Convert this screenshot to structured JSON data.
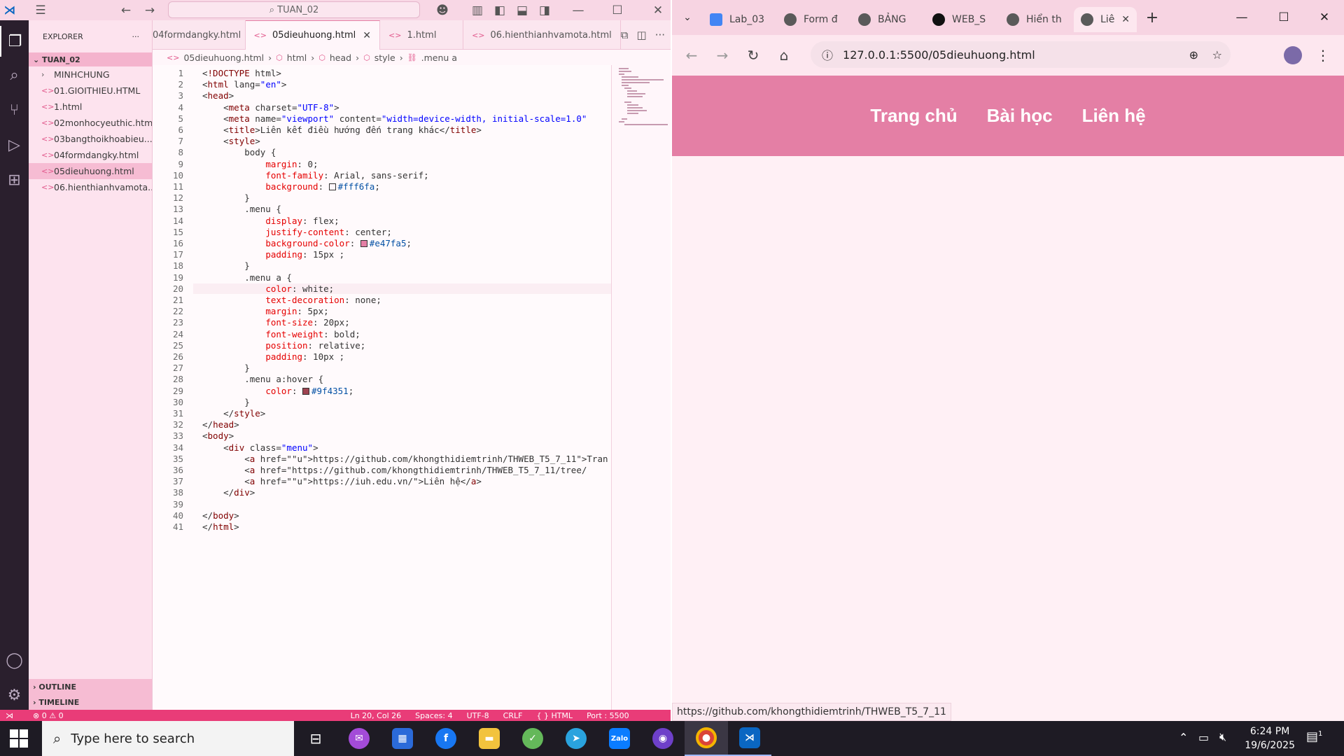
{
  "vscode": {
    "search": "TUAN_02",
    "explorer_label": "EXPLORER",
    "folder": "TUAN_02",
    "files": [
      "MINHCHUNG",
      "01.GIOITHIEU.HTML",
      "1.html",
      "02monhocyeuthic.html",
      "03bangthoikhoabieu....",
      "04formdangky.html",
      "05dieuhuong.html",
      "06.hienthianhvamota...."
    ],
    "outline": "OUTLINE",
    "timeline": "TIMELINE",
    "tabs": [
      "04formdangky.html",
      "05dieuhuong.html",
      "1.html",
      "06.hienthianhvamota.html"
    ],
    "breadcrumb": [
      "05dieuhuong.html",
      "html",
      "head",
      "style",
      ".menu a"
    ],
    "status": {
      "errors": "⊗ 0 ⚠ 0",
      "pos": "Ln 20, Col 26",
      "spaces": "Spaces: 4",
      "enc": "UTF-8",
      "eol": "CRLF",
      "lang": "{ } HTML",
      "port": "Port : 5500"
    },
    "code_lines": [
      "<!DOCTYPE html>",
      "<html lang=\"en\">",
      "<head>",
      "    <meta charset=\"UTF-8\">",
      "    <meta name=\"viewport\" content=\"width=device-width, initial-scale=1.0\"",
      "    <title>Liên kết điều hướng đến trang khác</title>",
      "    <style>",
      "        body {",
      "            margin: 0;",
      "            font-family: Arial, sans-serif;",
      "            background: #fff6fa;",
      "        }",
      "        .menu {",
      "            display: flex;",
      "            justify-content: center;",
      "            background-color: #e47fa5;",
      "            padding: 15px ;",
      "        }",
      "        .menu a {",
      "            color: white;",
      "            text-decoration: none;",
      "            margin: 5px;",
      "            font-size: 20px;",
      "            font-weight: bold;",
      "            position: relative;",
      "            padding: 10px ;",
      "        }",
      "        .menu a:hover {",
      "            color: #9f4351;",
      "        }",
      "    </style>",
      "</head>",
      "<body>",
      "    <div class=\"menu\">",
      "        <a href=\"https://github.com/khongthidiemtrinh/THWEB_T5_7_11\">Tran",
      "        <a href=\"https://github.com/khongthidiemtrinh/THWEB_T5_7_11/tree/",
      "        <a href=\"https://iuh.edu.vn/\">Liên hệ</a>",
      "    </div>",
      "",
      "</body>",
      "</html>"
    ]
  },
  "chrome": {
    "tabs": [
      "Lab_03",
      "Form đ",
      "BẢNG",
      "WEB_S",
      "Hiển th",
      "Liê"
    ],
    "url": "127.0.0.1:5500/05dieuhuong.html",
    "menu": [
      "Trang chủ",
      "Bài học",
      "Liên hệ"
    ],
    "hover_url": "https://github.com/khongthidiemtrinh/THWEB_T5_7_11"
  },
  "taskbar": {
    "search_placeholder": "Type here to search",
    "time": "6:24 PM",
    "date": "19/6/2025",
    "notif": "1"
  },
  "colors": {
    "menu_bg": "#e47fa5",
    "page_bg": "#fff6fa",
    "hover": "#9f4351",
    "status": "#e93c78"
  }
}
